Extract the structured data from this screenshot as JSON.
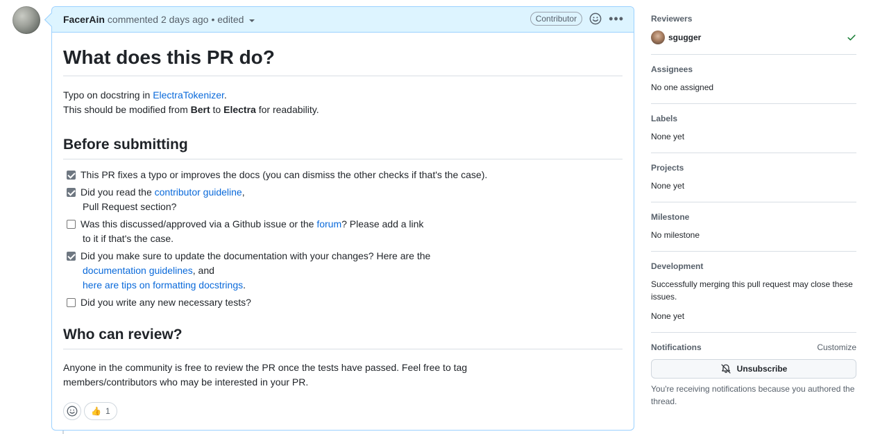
{
  "comment": {
    "author": "FacerAin",
    "meta": "commented 2 days ago",
    "edited": "• edited",
    "badge": "Contributor",
    "h1": "What does this PR do?",
    "intro_prefix": "Typo on docstring in ",
    "intro_link": "ElectraTokenizer",
    "intro_suffix": ".",
    "line2_a": "This should be modified from ",
    "line2_b1": "Bert",
    "line2_c": " to ",
    "line2_b2": "Electra",
    "line2_d": " for readability.",
    "h2_before": "Before submitting",
    "checklist": {
      "item1": "This PR fixes a typo or improves the docs (you can dismiss the other checks if that's the case).",
      "item2_pre": "Did you read the ",
      "item2_link": "contributor guideline",
      "item2_post": ",",
      "item2_line2": "Pull Request section?",
      "item3_pre": "Was this discussed/approved via a Github issue or the ",
      "item3_link": "forum",
      "item3_post": "? Please add a link",
      "item3_line2": "to it if that's the case.",
      "item4_pre": "Did you make sure to update the documentation with your changes? Here are the",
      "item4_link1": "documentation guidelines",
      "item4_mid": ", and",
      "item4_link2": "here are tips on formatting docstrings",
      "item4_post": ".",
      "item5": "Did you write any new necessary tests?"
    },
    "h2_who": "Who can review?",
    "who_text_1": "Anyone in the community is free to review the PR once the tests have passed. Feel free to tag",
    "who_text_2": "members/contributors who may be interested in your PR.",
    "reaction_count": "1"
  },
  "sidebar": {
    "reviewers_title": "Reviewers",
    "reviewer_name": "sgugger",
    "assignees_title": "Assignees",
    "assignees_value": "No one assigned",
    "labels_title": "Labels",
    "labels_value": "None yet",
    "projects_title": "Projects",
    "projects_value": "None yet",
    "milestone_title": "Milestone",
    "milestone_value": "No milestone",
    "development_title": "Development",
    "development_text": "Successfully merging this pull request may close these issues.",
    "development_value": "None yet",
    "notifications_title": "Notifications",
    "customize": "Customize",
    "unsubscribe": "Unsubscribe",
    "notif_note": "You're receiving notifications because you authored the thread."
  },
  "colors": {
    "link": "#0969da",
    "header_bg": "#ddf4ff",
    "check_green": "#1a7f37"
  }
}
